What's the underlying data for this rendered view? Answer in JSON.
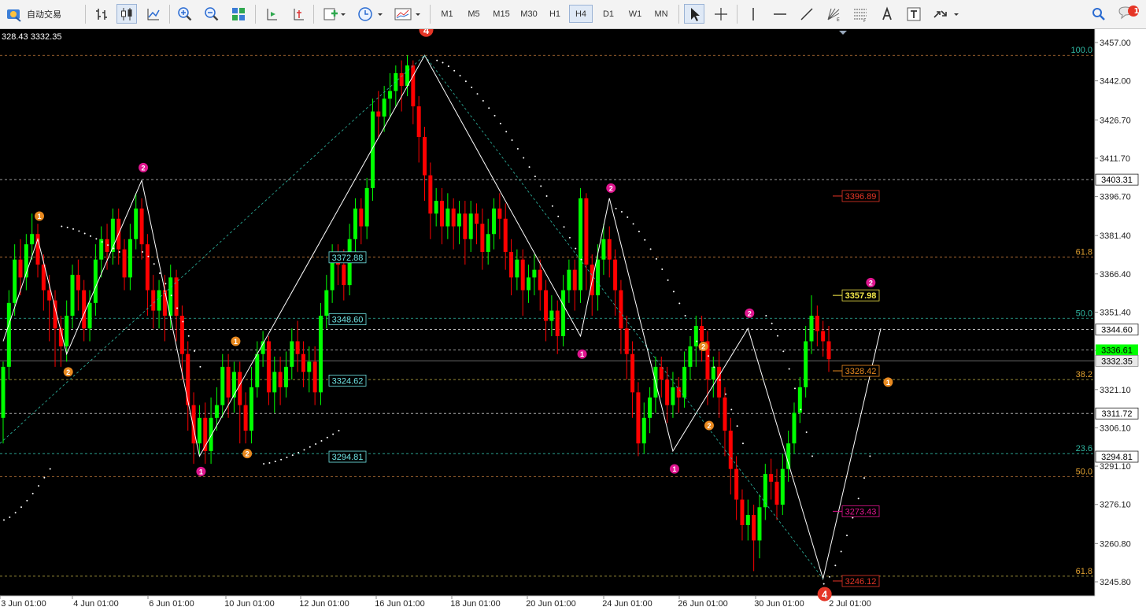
{
  "toolbar": {
    "autotrade_label": "自动交易",
    "timeframes": [
      "M1",
      "M5",
      "M15",
      "M30",
      "H1",
      "H4",
      "D1",
      "W1",
      "MN"
    ],
    "active_timeframe": "H4",
    "notification_count": "1",
    "icons": [
      "bar-chart-icon",
      "candlestick-icon",
      "line-chart-icon",
      "zoom-in-icon",
      "zoom-out-icon",
      "tile-windows-icon",
      "autoscroll-icon",
      "chart-shift-icon",
      "new-indicator-icon",
      "clock-icon",
      "templates-icon",
      "cursor-icon",
      "crosshair-icon",
      "vertical-line-icon",
      "horizontal-line-icon",
      "trendline-icon",
      "gann-icon",
      "fibonacci-icon",
      "text-icon",
      "text-label-icon",
      "arrows-icon",
      "search-icon",
      "notification-icon"
    ]
  },
  "chart_header": "328.43 3332.35",
  "colors": {
    "background": "#000000",
    "bull": "#00ff00",
    "bear": "#ff0000",
    "accent_pink": "#e0158f",
    "accent_orange": "#e8891f"
  },
  "chart_data": {
    "type": "candlestick",
    "symbol_timeframe": "H4",
    "ylim": [
      3240,
      3460
    ],
    "y_ticks": [
      "3457.00",
      "3442.00",
      "3426.70",
      "3411.70",
      "3396.70",
      "3381.40",
      "3366.40",
      "3351.40",
      "3336.40",
      "3321.10",
      "3306.10",
      "3291.10",
      "3276.10",
      "3260.80",
      "3245.80"
    ],
    "x_labels": [
      "3 Jun 01:00",
      "4 Jun 01:00",
      "6 Jun 01:00",
      "10 Jun 01:00",
      "12 Jun 01:00",
      "16 Jun 01:00",
      "18 Jun 01:00",
      "20 Jun 01:00",
      "24 Jun 01:00",
      "26 Jun 01:00",
      "30 Jun 01:00",
      "2 Jul 01:00"
    ],
    "current_bid": "3332.35",
    "current_ask": "3336.61",
    "level_tags": [
      {
        "price": 3403.31,
        "label": "3403.31"
      },
      {
        "price": 3344.6,
        "label": "3344.60"
      },
      {
        "price": 3311.72,
        "label": "3311.72"
      },
      {
        "price": 3294.81,
        "label": "3294.81"
      }
    ],
    "price_labels": [
      {
        "price": 3372.88,
        "label": "3372.88",
        "color": "cyan"
      },
      {
        "price": 3348.6,
        "label": "3348.60",
        "color": "cyan"
      },
      {
        "price": 3324.62,
        "label": "3324.62",
        "color": "cyan"
      },
      {
        "price": 3294.81,
        "label": "3294.81",
        "color": "cyan"
      },
      {
        "price": 3396.89,
        "label": "3396.89",
        "color": "red"
      },
      {
        "price": 3357.98,
        "label": "3357.98",
        "color": "yellow"
      },
      {
        "price": 3328.42,
        "label": "3328.42",
        "color": "orange"
      },
      {
        "price": 3273.43,
        "label": "3273.43",
        "color": "pink"
      },
      {
        "price": 3246.12,
        "label": "3246.12",
        "color": "red"
      }
    ],
    "fib_labels": [
      {
        "price": 3452,
        "label": "100.0"
      },
      {
        "price": 3373,
        "label": "61.8"
      },
      {
        "price": 3349,
        "label": "50.0"
      },
      {
        "price": 3325,
        "label": "38.2"
      },
      {
        "price": 3296,
        "label": "23.6"
      },
      {
        "price": 3287,
        "label": "50.0"
      },
      {
        "price": 3248,
        "label": "61.8"
      }
    ],
    "wave_markers": [
      "4",
      "2",
      "1",
      "2",
      "1",
      "1",
      "2",
      "2",
      "1",
      "2",
      "1",
      "2",
      "2",
      "2",
      "1",
      "4"
    ],
    "candles": [
      [
        3310,
        3330,
        3300,
        3332
      ],
      [
        3330,
        3355,
        3325,
        3360
      ],
      [
        3355,
        3372,
        3350,
        3378
      ],
      [
        3372,
        3365,
        3358,
        3380
      ],
      [
        3365,
        3378,
        3360,
        3382
      ],
      [
        3378,
        3382,
        3372,
        3390
      ],
      [
        3382,
        3370,
        3365,
        3386
      ],
      [
        3370,
        3360,
        3352,
        3374
      ],
      [
        3360,
        3356,
        3340,
        3366
      ],
      [
        3356,
        3345,
        3330,
        3360
      ],
      [
        3345,
        3338,
        3330,
        3350
      ],
      [
        3338,
        3350,
        3332,
        3356
      ],
      [
        3350,
        3366,
        3345,
        3370
      ],
      [
        3366,
        3360,
        3352,
        3372
      ],
      [
        3360,
        3345,
        3340,
        3364
      ],
      [
        3345,
        3355,
        3340,
        3360
      ],
      [
        3355,
        3372,
        3350,
        3378
      ],
      [
        3372,
        3380,
        3365,
        3385
      ],
      [
        3380,
        3375,
        3368,
        3386
      ],
      [
        3375,
        3388,
        3370,
        3392
      ],
      [
        3388,
        3376,
        3370,
        3392
      ],
      [
        3376,
        3365,
        3360,
        3380
      ],
      [
        3365,
        3380,
        3360,
        3386
      ],
      [
        3380,
        3392,
        3376,
        3398
      ],
      [
        3392,
        3378,
        3372,
        3396
      ],
      [
        3378,
        3360,
        3350,
        3382
      ],
      [
        3360,
        3352,
        3345,
        3366
      ],
      [
        3352,
        3360,
        3345,
        3364
      ],
      [
        3360,
        3350,
        3340,
        3366
      ],
      [
        3350,
        3365,
        3345,
        3370
      ],
      [
        3365,
        3350,
        3340,
        3368
      ],
      [
        3350,
        3335,
        3325,
        3354
      ],
      [
        3335,
        3315,
        3305,
        3340
      ],
      [
        3315,
        3300,
        3292,
        3320
      ],
      [
        3300,
        3310,
        3295,
        3315
      ],
      [
        3310,
        3297,
        3292,
        3316
      ],
      [
        3297,
        3310,
        3292,
        3318
      ],
      [
        3310,
        3315,
        3305,
        3322
      ],
      [
        3315,
        3330,
        3310,
        3335
      ],
      [
        3330,
        3318,
        3310,
        3335
      ],
      [
        3318,
        3328,
        3312,
        3332
      ],
      [
        3328,
        3315,
        3300,
        3332
      ],
      [
        3315,
        3305,
        3300,
        3320
      ],
      [
        3305,
        3322,
        3300,
        3330
      ],
      [
        3322,
        3335,
        3318,
        3340
      ],
      [
        3335,
        3340,
        3330,
        3344
      ],
      [
        3340,
        3320,
        3315,
        3342
      ],
      [
        3320,
        3328,
        3312,
        3334
      ],
      [
        3328,
        3322,
        3315,
        3334
      ],
      [
        3322,
        3330,
        3318,
        3336
      ],
      [
        3330,
        3340,
        3325,
        3345
      ],
      [
        3340,
        3335,
        3328,
        3348
      ],
      [
        3335,
        3328,
        3322,
        3340
      ],
      [
        3328,
        3332,
        3320,
        3338
      ],
      [
        3332,
        3320,
        3315,
        3338
      ],
      [
        3320,
        3350,
        3315,
        3355
      ],
      [
        3350,
        3360,
        3345,
        3366
      ],
      [
        3360,
        3372,
        3355,
        3378
      ],
      [
        3372,
        3370,
        3362,
        3378
      ],
      [
        3370,
        3362,
        3356,
        3376
      ],
      [
        3362,
        3380,
        3358,
        3386
      ],
      [
        3380,
        3392,
        3375,
        3396
      ],
      [
        3392,
        3385,
        3378,
        3396
      ],
      [
        3385,
        3400,
        3380,
        3404
      ],
      [
        3400,
        3430,
        3395,
        3435
      ],
      [
        3430,
        3428,
        3420,
        3438
      ],
      [
        3428,
        3435,
        3422,
        3440
      ],
      [
        3435,
        3438,
        3428,
        3445
      ],
      [
        3438,
        3445,
        3432,
        3448
      ],
      [
        3445,
        3440,
        3430,
        3450
      ],
      [
        3440,
        3448,
        3436,
        3452
      ],
      [
        3448,
        3432,
        3425,
        3450
      ],
      [
        3432,
        3420,
        3410,
        3436
      ],
      [
        3420,
        3405,
        3395,
        3424
      ],
      [
        3405,
        3390,
        3380,
        3410
      ],
      [
        3390,
        3395,
        3385,
        3400
      ],
      [
        3395,
        3385,
        3378,
        3400
      ],
      [
        3385,
        3392,
        3380,
        3398
      ],
      [
        3392,
        3385,
        3376,
        3396
      ],
      [
        3385,
        3390,
        3378,
        3395
      ],
      [
        3390,
        3380,
        3370,
        3395
      ],
      [
        3380,
        3390,
        3375,
        3395
      ],
      [
        3390,
        3386,
        3378,
        3394
      ],
      [
        3386,
        3375,
        3368,
        3392
      ],
      [
        3375,
        3382,
        3370,
        3388
      ],
      [
        3382,
        3392,
        3376,
        3396
      ],
      [
        3392,
        3388,
        3380,
        3398
      ],
      [
        3388,
        3375,
        3368,
        3394
      ],
      [
        3375,
        3365,
        3358,
        3380
      ],
      [
        3365,
        3372,
        3360,
        3376
      ],
      [
        3372,
        3360,
        3350,
        3376
      ],
      [
        3360,
        3365,
        3355,
        3370
      ],
      [
        3365,
        3368,
        3358,
        3374
      ],
      [
        3368,
        3360,
        3352,
        3372
      ],
      [
        3360,
        3348,
        3340,
        3364
      ],
      [
        3348,
        3352,
        3342,
        3358
      ],
      [
        3352,
        3342,
        3335,
        3356
      ],
      [
        3342,
        3360,
        3338,
        3366
      ],
      [
        3360,
        3368,
        3355,
        3372
      ],
      [
        3368,
        3360,
        3352,
        3372
      ],
      [
        3360,
        3396,
        3355,
        3400
      ],
      [
        3396,
        3370,
        3360,
        3398
      ],
      [
        3370,
        3358,
        3350,
        3374
      ],
      [
        3358,
        3372,
        3352,
        3378
      ],
      [
        3372,
        3380,
        3366,
        3386
      ],
      [
        3380,
        3372,
        3365,
        3385
      ],
      [
        3372,
        3360,
        3350,
        3376
      ],
      [
        3360,
        3345,
        3335,
        3364
      ],
      [
        3345,
        3335,
        3325,
        3350
      ],
      [
        3335,
        3320,
        3310,
        3340
      ],
      [
        3320,
        3300,
        3295,
        3324
      ],
      [
        3300,
        3310,
        3296,
        3316
      ],
      [
        3310,
        3318,
        3304,
        3322
      ],
      [
        3318,
        3330,
        3312,
        3334
      ],
      [
        3330,
        3325,
        3318,
        3334
      ],
      [
        3325,
        3315,
        3308,
        3330
      ],
      [
        3315,
        3322,
        3310,
        3328
      ],
      [
        3322,
        3318,
        3312,
        3326
      ],
      [
        3318,
        3330,
        3314,
        3336
      ],
      [
        3330,
        3338,
        3325,
        3342
      ],
      [
        3338,
        3346,
        3330,
        3350
      ],
      [
        3346,
        3340,
        3332,
        3350
      ],
      [
        3340,
        3325,
        3315,
        3344
      ],
      [
        3325,
        3330,
        3318,
        3334
      ],
      [
        3330,
        3318,
        3310,
        3336
      ],
      [
        3318,
        3305,
        3295,
        3322
      ],
      [
        3305,
        3290,
        3280,
        3310
      ],
      [
        3290,
        3278,
        3270,
        3295
      ],
      [
        3278,
        3268,
        3262,
        3282
      ],
      [
        3268,
        3272,
        3262,
        3278
      ],
      [
        3272,
        3262,
        3250,
        3276
      ],
      [
        3262,
        3275,
        3255,
        3280
      ],
      [
        3275,
        3288,
        3270,
        3292
      ],
      [
        3288,
        3285,
        3278,
        3294
      ],
      [
        3285,
        3276,
        3270,
        3290
      ],
      [
        3276,
        3290,
        3272,
        3296
      ],
      [
        3290,
        3300,
        3285,
        3305
      ],
      [
        3300,
        3312,
        3296,
        3316
      ],
      [
        3312,
        3322,
        3308,
        3326
      ],
      [
        3322,
        3340,
        3318,
        3346
      ],
      [
        3340,
        3350,
        3335,
        3358
      ],
      [
        3350,
        3344,
        3338,
        3354
      ],
      [
        3344,
        3340,
        3334,
        3348
      ],
      [
        3340,
        3333,
        3328,
        3346
      ]
    ]
  }
}
